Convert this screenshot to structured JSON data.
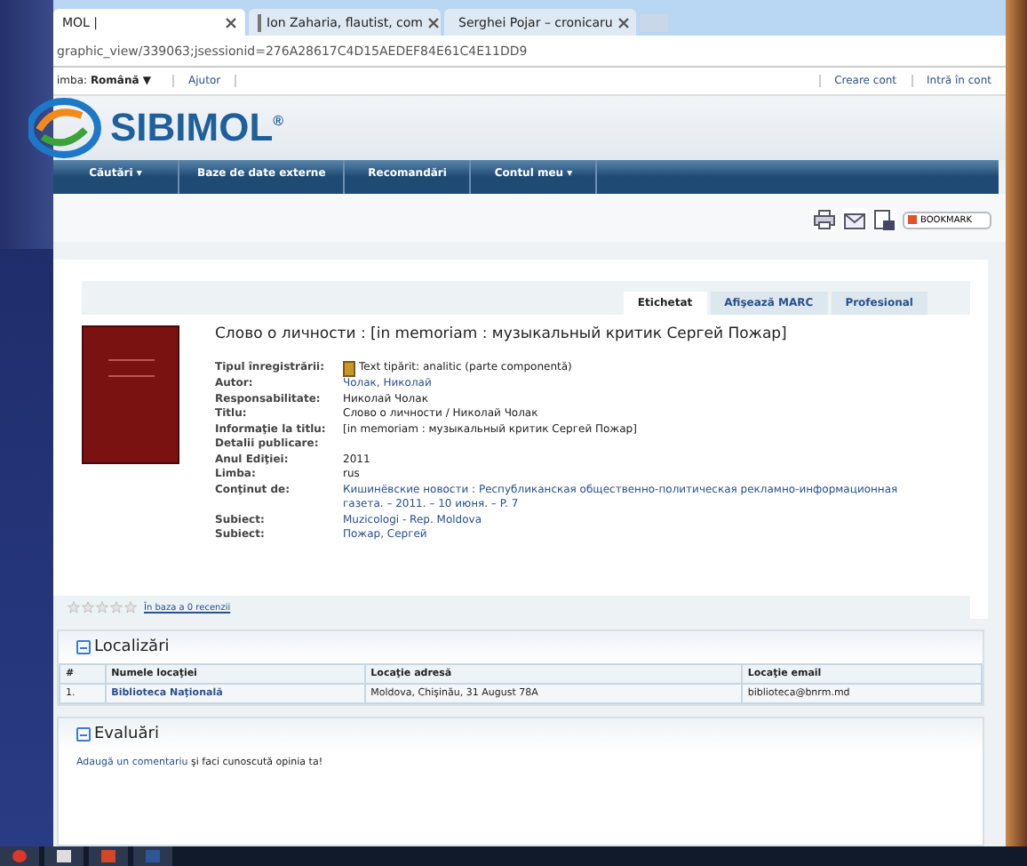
{
  "browser": {
    "tabs": [
      {
        "title": "MOL |",
        "selected": true
      },
      {
        "title": "Ion Zaharia, flautist, com",
        "selected": false
      },
      {
        "title": "Serghei Pojar – cronicaru",
        "selected": false
      }
    ],
    "url": "graphic_view/339063;jsessionid=276A28617C4D15AEDEF84E61C4E11DD9"
  },
  "topbar": {
    "language_label": "imba:",
    "language": "Română ▼",
    "help": "Ajutor",
    "links": [
      "Creare cont",
      "Intră în cont"
    ]
  },
  "logo": {
    "text": "SIBIMOL",
    "mark": "®"
  },
  "nav": [
    "Căutări ▾",
    "Baze de date externe",
    "Recomandări",
    "Contul meu ▾"
  ],
  "bookmark": "BOOKMARK",
  "record_tabs": [
    {
      "label": "Etichetat",
      "selected": true
    },
    {
      "label": "Afişează MARC",
      "selected": false
    },
    {
      "label": "Profesional",
      "selected": false
    }
  ],
  "record": {
    "title": "Слово о личности : [in memoriam : музыкальный критик Сергей Пожар]",
    "fields": [
      {
        "label": "Tipul înregistrării:",
        "value": "Text tipărit: analitic (parte componentă)",
        "kind": "type"
      },
      {
        "label": "Autor:",
        "value": "Чолак, Николай",
        "kind": "link"
      },
      {
        "label": "Responsabilitate:",
        "value": "Николай Чолак",
        "kind": "text"
      },
      {
        "label": "Titlu:",
        "value": "Слово о личности / Николай Чолак",
        "kind": "text"
      },
      {
        "label": "Informaţie la titlu:",
        "value": "[in memoriam : музыкальный критик Сергей Пожар]",
        "kind": "text"
      },
      {
        "label": "Detalii publicare:"
      },
      {
        "label": "Anul Ediţiei:",
        "value": "2011",
        "kind": "text"
      },
      {
        "label": "Limba:",
        "value": "rus",
        "kind": "text"
      },
      {
        "label": "Conţinut de:",
        "value": "Кишинёвские новости : Республиканская общественно-политическая рекламно-информационная газета. – 2011. – 10 июня. – P. 7",
        "kind": "link"
      },
      {
        "label": "Subiect:",
        "value": "Muzicologi - Rep. Moldova",
        "kind": "link"
      },
      {
        "label": "Subiect:",
        "value": "Пожар, Сергей",
        "kind": "link"
      }
    ]
  },
  "rating": {
    "stars": 0,
    "reviews": "În baza a 0 recenzii"
  },
  "locations": {
    "title": "Localizări",
    "columns": [
      "#",
      "Numele locaţiei",
      "Locaţie adresă",
      "Locaţie email"
    ],
    "rows": [
      [
        "1.",
        "Biblioteca Naţională",
        "Moldova, Chişinău, 31 August 78A",
        "biblioteca@bnrm.md"
      ]
    ]
  },
  "reviews": {
    "title": "Evaluări",
    "link": "Adaugă un comentariu",
    "text": " şi faci cunoscută opinia ta!"
  }
}
